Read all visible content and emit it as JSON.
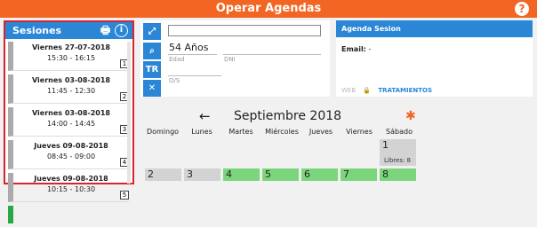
{
  "app": {
    "title": "Operar Agendas",
    "help": "?"
  },
  "sessions": {
    "title": "Sesiones",
    "print_icon": "printer-icon",
    "info_icon": "info-icon",
    "items": [
      {
        "date": "Viernes 27-07-2018",
        "time": "15:30 - 16:15",
        "num": "1"
      },
      {
        "date": "Viernes 03-08-2018",
        "time": "11:45 - 12:30",
        "num": "2"
      },
      {
        "date": "Viernes 03-08-2018",
        "time": "14:00 - 14:45",
        "num": "3"
      },
      {
        "date": "Jueves 09-08-2018",
        "time": "08:45 - 09:00",
        "num": "4"
      },
      {
        "date": "Jueves 09-08-2018",
        "time": "10:15 - 10:30",
        "num": "5"
      }
    ]
  },
  "patient": {
    "search_value": "",
    "age": "54 Años",
    "edad_label": "Edad",
    "dni_label": "DNI",
    "os_label": "O/S",
    "tr_label": "TR",
    "close_label": "✕"
  },
  "agenda_session": {
    "title": "Agenda Sesion",
    "email_label": "Email:",
    "email_value": "-",
    "web_label": "WEB",
    "treatments_label": "TRATAMIENTOS"
  },
  "calendar": {
    "month": "Septiembre 2018",
    "days": [
      "Domingo",
      "Lunes",
      "Martes",
      "Miércoles",
      "Jueves",
      "Viernes",
      "Sábado"
    ],
    "first_day": "1",
    "first_day_libres": "Libres: 8",
    "row2": [
      "2",
      "3",
      "4",
      "5",
      "6",
      "7",
      "8"
    ]
  }
}
